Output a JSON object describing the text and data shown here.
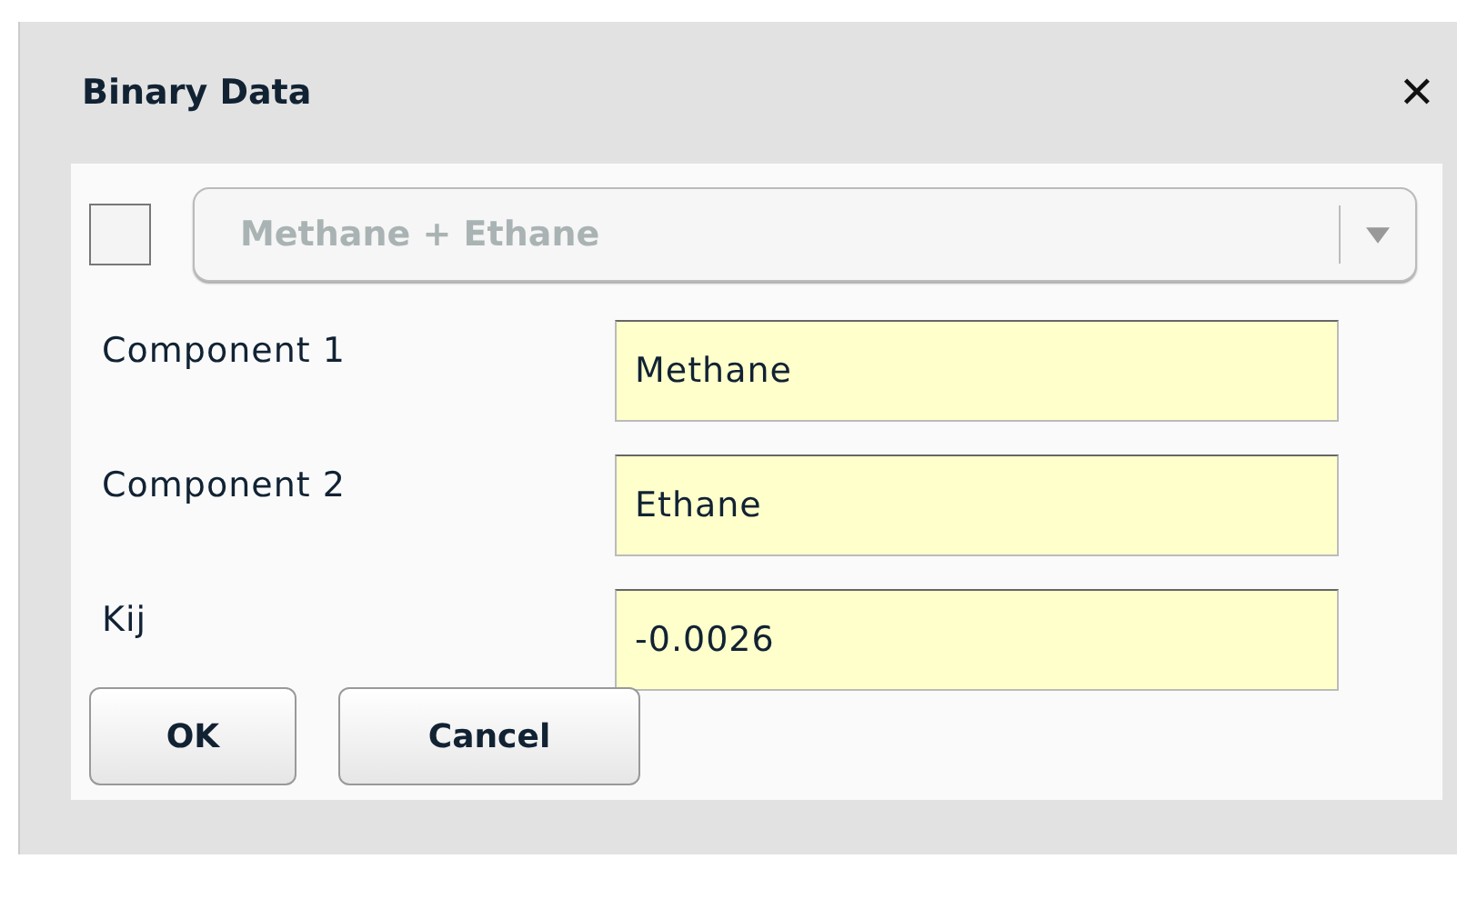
{
  "window": {
    "title": "Binary Data",
    "close": "✕"
  },
  "pair": {
    "checked": false,
    "dropdown": {
      "value": "Methane + Ethane",
      "disabled": true
    }
  },
  "fields": [
    {
      "label": "Component 1",
      "value": "Methane"
    },
    {
      "label": "Component 2",
      "value": "Ethane"
    },
    {
      "label": "Kij",
      "value": "-0.0026"
    }
  ],
  "buttons": [
    "OK",
    "Cancel"
  ]
}
